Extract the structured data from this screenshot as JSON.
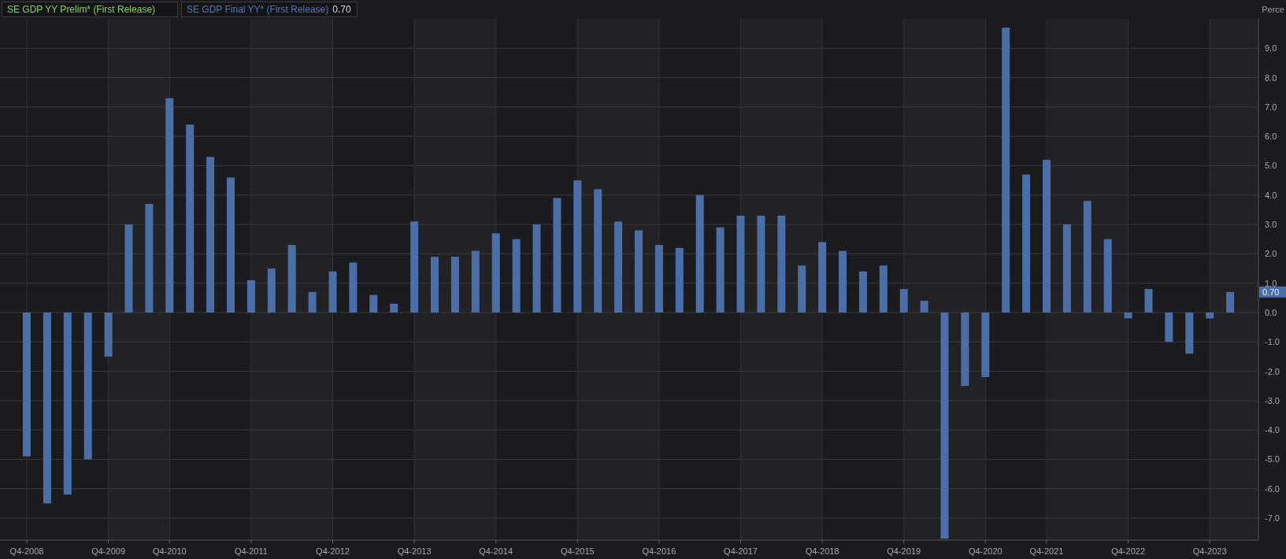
{
  "legend": [
    {
      "label": "SE GDP YY Prelim* (First Release)",
      "color": "#7ed957"
    },
    {
      "color": "#4f79b7",
      "value": "0.70"
    }
  ],
  "axis_unit": "Perce",
  "last_value_tag": "0.70",
  "chart": {
    "chart_data": {
      "type": "bar",
      "series": [
        {
          "name": "SE GDP Final YY* (First Release)",
          "color": "#4a6fa8",
          "values": [
            -4.9,
            -6.5,
            -6.2,
            -5.0,
            -1.5,
            3.0,
            3.7,
            7.3,
            6.4,
            5.3,
            4.6,
            1.1,
            1.5,
            2.3,
            0.7,
            1.4,
            1.7,
            0.6,
            0.3,
            3.1,
            1.9,
            1.9,
            2.1,
            2.7,
            2.5,
            3.0,
            3.9,
            4.5,
            4.2,
            3.1,
            2.8,
            2.3,
            2.2,
            4.0,
            2.9,
            3.3,
            3.3,
            3.3,
            1.6,
            2.4,
            2.1,
            1.4,
            1.6,
            0.8,
            0.4,
            -7.7,
            -2.5,
            -2.2,
            9.7,
            4.7,
            5.2,
            3.0,
            3.8,
            2.5,
            -0.2,
            0.8,
            -1.0,
            -1.4,
            -0.2,
            0.7
          ]
        }
      ],
      "grid": true,
      "ylim": [
        -7.75,
        10
      ],
      "yticks": [
        {
          "value": 9,
          "label": "9.0"
        },
        {
          "value": 8,
          "label": "8.0"
        },
        {
          "value": 7,
          "label": "7.0"
        },
        {
          "value": 6,
          "label": "6.0"
        },
        {
          "value": 5,
          "label": "5.0"
        },
        {
          "value": 4,
          "label": "4.0"
        },
        {
          "value": 3,
          "label": "3.0"
        },
        {
          "value": 2,
          "label": "2.0"
        },
        {
          "value": 1,
          "label": "1.0"
        },
        {
          "value": 0,
          "label": "0.0"
        },
        {
          "value": -1,
          "label": "-1.0"
        },
        {
          "value": -2,
          "label": "-2.0"
        },
        {
          "value": -3,
          "label": "-3.0"
        },
        {
          "value": -4,
          "label": "-4.0"
        },
        {
          "value": -5,
          "label": "-5.0"
        },
        {
          "value": -6,
          "label": "-6.0"
        },
        {
          "value": -7,
          "label": "-7.0"
        }
      ],
      "categories": [
        "Q4-2008",
        null,
        null,
        null,
        "Q4-2009",
        null,
        null,
        "Q4-2010",
        null,
        null,
        null,
        "Q4-2011",
        null,
        null,
        null,
        "Q4-2012",
        null,
        null,
        null,
        "Q4-2013",
        null,
        null,
        null,
        "Q4-2014",
        null,
        null,
        null,
        "Q4-2015",
        null,
        null,
        null,
        "Q4-2016",
        null,
        null,
        null,
        "Q4-2017",
        null,
        null,
        null,
        "Q4-2018",
        null,
        null,
        null,
        "Q4-2019",
        null,
        null,
        null,
        "Q4-2020",
        null,
        null,
        "Q4-2021",
        null,
        null,
        null,
        "Q4-2022",
        null,
        null,
        null,
        "Q4-2023",
        null
      ]
    }
  }
}
